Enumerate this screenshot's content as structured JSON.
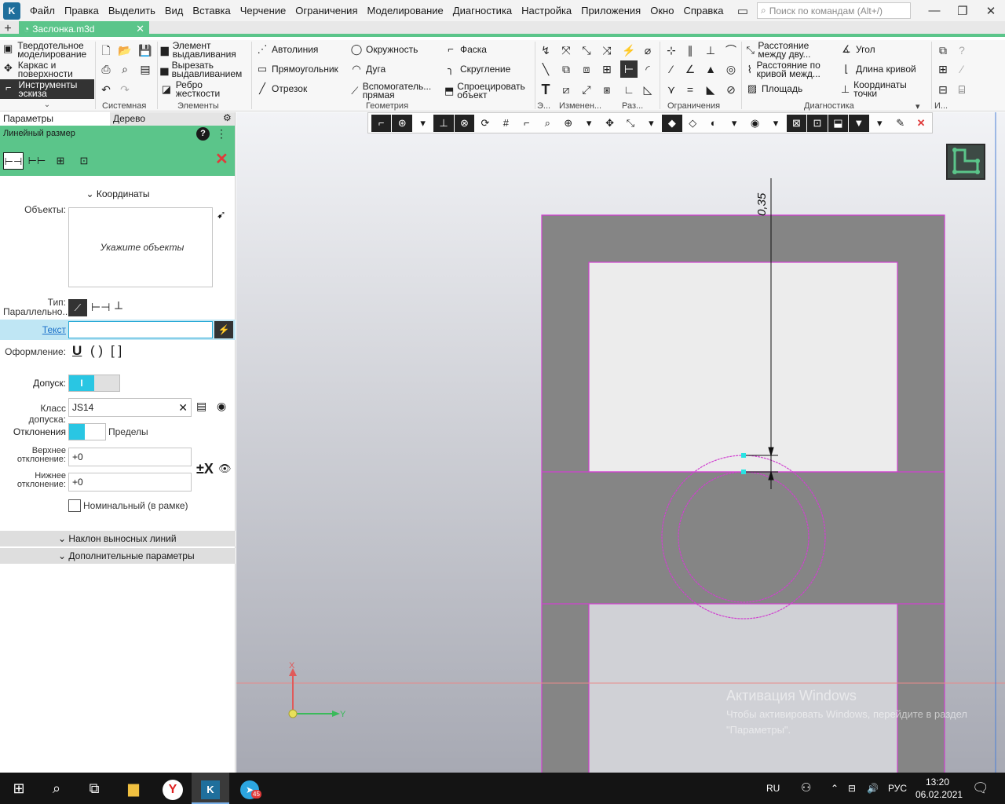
{
  "menubar": {
    "items": [
      "Файл",
      "Правка",
      "Выделить",
      "Вид",
      "Вставка",
      "Черчение",
      "Ограничения",
      "Моделирование",
      "Диагностика",
      "Настройка",
      "Приложения",
      "Окно",
      "Справка"
    ],
    "search_placeholder": "Поиск по командам (Alt+/)"
  },
  "tabs": {
    "document": "Заслонка.m3d"
  },
  "ribbon": {
    "modes": [
      "Твердотельное моделирование",
      "Каркас и поверхности",
      "Инструменты эскиза"
    ],
    "elements": [
      "Элемент выдавливания",
      "Вырезать выдавливанием",
      "Ребро жесткости"
    ],
    "geometry": [
      "Автолиния",
      "Окружность",
      "Фаска",
      "Прямоугольник",
      "Дуга",
      "Скругление",
      "Отрезок",
      "Вспомогатель... прямая",
      "Спроецировать объект"
    ],
    "diagnostics": [
      "Расстояние между дву...",
      "Угол",
      "Расстояние по кривой межд...",
      "Длина кривой",
      "Площадь",
      "Координаты точки"
    ],
    "group_labels": [
      "Системная",
      "Элементы",
      "Геометрия",
      "Э...",
      "Изменен...",
      "Раз...",
      "Ограничения",
      "Диагностика",
      "И..."
    ]
  },
  "panel": {
    "tabs": [
      "Параметры",
      "Дерево"
    ],
    "title": "Линейный размер",
    "coordinates_header": "Координаты",
    "objects_label": "Объекты:",
    "objects_hint": "Укажите объекты",
    "type_label": "Тип:",
    "type_value": "Параллельно...",
    "text_label": "Текст",
    "text_value": "",
    "format_label": "Оформление:",
    "format_options": [
      "U",
      "( )",
      "[ ]"
    ],
    "tolerance_label": "Допуск:",
    "tolerance_on": true,
    "tolerance_class_label": "Класс допуска:",
    "tolerance_class": "JS14",
    "deviations_label": "Отклонения",
    "limits_label": "Пределы",
    "upper_label": "Верхнее отклонение:",
    "upper_value": "+0",
    "lower_label": "Нижнее отклонение:",
    "lower_value": "+0",
    "nominal_label": "Номинальный (в рамке)",
    "nominal_checked": false,
    "section_slope": "Наклон выносных линий",
    "section_extra": "Дополнительные параметры"
  },
  "canvas": {
    "dimension_text": "0,35",
    "axis_x": "X",
    "axis_y": "Y",
    "watermark_title": "Активация Windows",
    "watermark_text": "Чтобы активировать Windows, перейдите в раздел \"Параметры\"."
  },
  "taskbar": {
    "language": "RU",
    "keyboard": "РУС",
    "time": "13:20",
    "date": "06.02.2021",
    "telegram_badge": "45"
  },
  "colors": {
    "accent": "#5bc58a",
    "sketch_outline": "#d040d0",
    "tolerance_toggle": "#29c6e3"
  }
}
